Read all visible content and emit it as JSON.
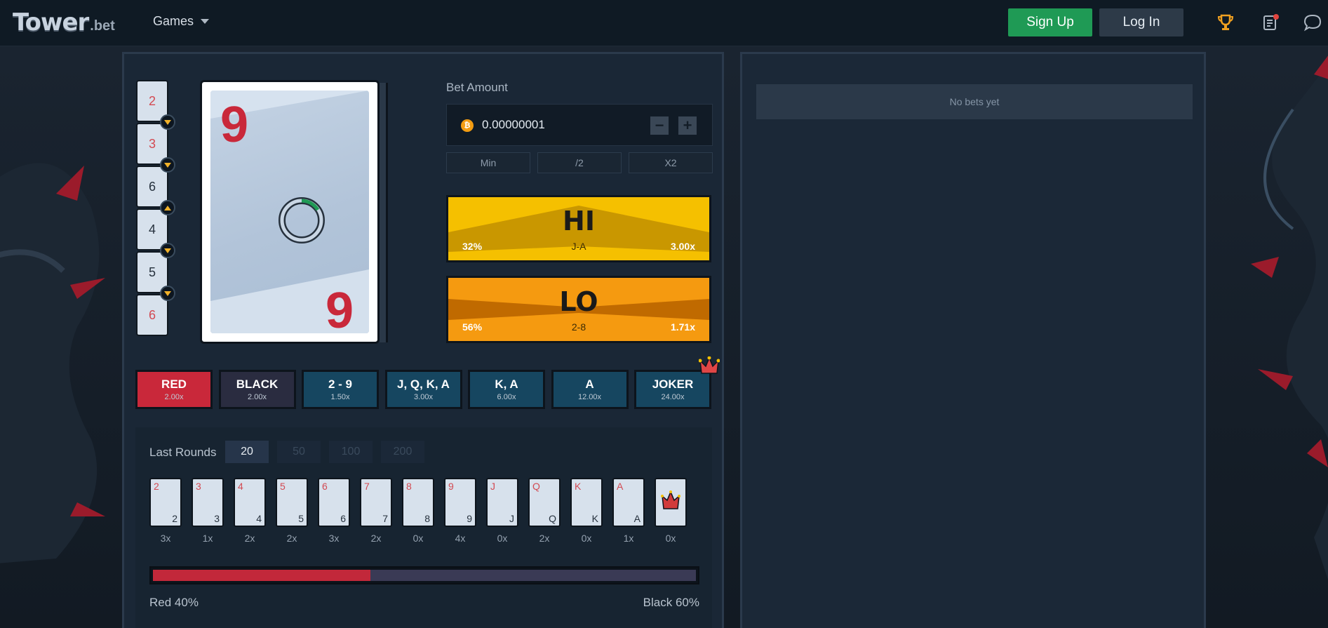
{
  "header": {
    "logo_main": "Tower",
    "logo_tld": ".bet",
    "games_label": "Games",
    "signup_label": "Sign Up",
    "login_label": "Log In"
  },
  "history_cards": [
    {
      "rank": "2",
      "color": "red"
    },
    {
      "rank": "3",
      "color": "red"
    },
    {
      "rank": "6",
      "color": "black"
    },
    {
      "rank": "4",
      "color": "black"
    },
    {
      "rank": "5",
      "color": "black"
    },
    {
      "rank": "6",
      "color": "red"
    }
  ],
  "history_arrows": [
    "down",
    "down",
    "up",
    "down",
    "down"
  ],
  "current_card": {
    "rank": "9",
    "color": "red"
  },
  "bet": {
    "label": "Bet Amount",
    "currency_icon": "bitcoin-icon",
    "amount": "0.00000001",
    "minus": "−",
    "plus": "+",
    "min_label": "Min",
    "half_label": "/2",
    "double_label": "X2"
  },
  "hi": {
    "title": "HI",
    "pct": "32%",
    "range": "J-A",
    "mult": "3.00x",
    "color": "#f0b400"
  },
  "lo": {
    "title": "LO",
    "pct": "56%",
    "range": "2-8",
    "mult": "1.71x",
    "color": "#f08c00"
  },
  "side_bets": [
    {
      "label": "RED",
      "mult": "2.00x",
      "color": "#c9283a"
    },
    {
      "label": "BLACK",
      "mult": "2.00x",
      "color": "#2a2c40"
    },
    {
      "label": "2 - 9",
      "mult": "1.50x",
      "color": "#164660"
    },
    {
      "label": "J, Q, K, A",
      "mult": "3.00x",
      "color": "#164660"
    },
    {
      "label": "K, A",
      "mult": "6.00x",
      "color": "#164660"
    },
    {
      "label": "A",
      "mult": "12.00x",
      "color": "#164660"
    },
    {
      "label": "JOKER",
      "mult": "24.00x",
      "color": "#164660"
    }
  ],
  "last_rounds": {
    "label": "Last Rounds",
    "options": [
      "20",
      "50",
      "100",
      "200"
    ],
    "selected": "20",
    "cards": [
      {
        "rank": "2",
        "count": "3x"
      },
      {
        "rank": "3",
        "count": "1x"
      },
      {
        "rank": "4",
        "count": "2x"
      },
      {
        "rank": "5",
        "count": "2x"
      },
      {
        "rank": "6",
        "count": "3x"
      },
      {
        "rank": "7",
        "count": "2x"
      },
      {
        "rank": "8",
        "count": "0x"
      },
      {
        "rank": "9",
        "count": "4x"
      },
      {
        "rank": "J",
        "count": "0x"
      },
      {
        "rank": "Q",
        "count": "2x"
      },
      {
        "rank": "K",
        "count": "0x"
      },
      {
        "rank": "A",
        "count": "1x"
      },
      {
        "rank": "joker",
        "count": "0x"
      }
    ],
    "red_label": "Red 40%",
    "black_label": "Black 60%",
    "red_fraction": 0.4
  },
  "bets_panel": {
    "empty_text": "No bets yet"
  }
}
